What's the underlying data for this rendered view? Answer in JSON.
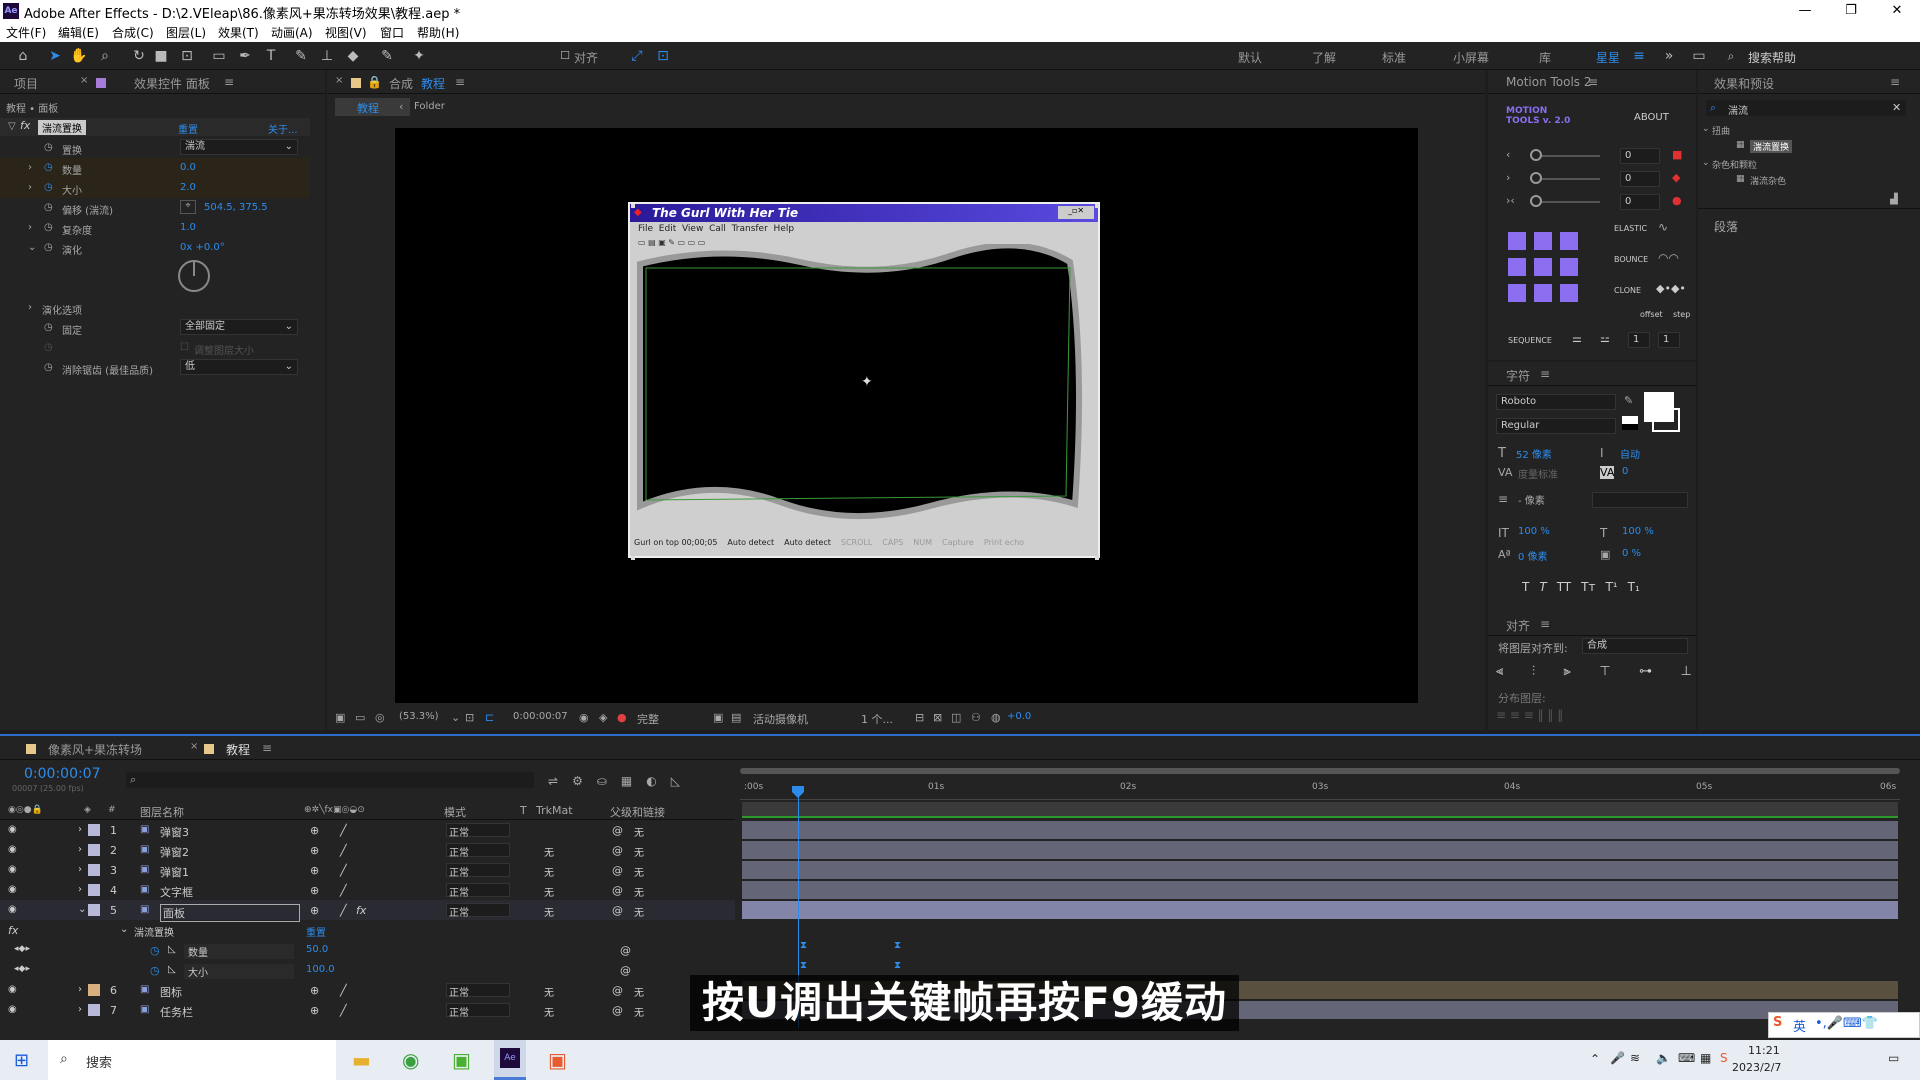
{
  "title_bar": {
    "app_title": "Adobe After Effects - D:\\2.VEleap\\86.像素风+果冻转场效果\\教程.aep *",
    "logo": "Ae"
  },
  "menu": [
    "文件(F)",
    "编辑(E)",
    "合成(C)",
    "图层(L)",
    "效果(T)",
    "动画(A)",
    "视图(V)",
    "窗口",
    "帮助(H)"
  ],
  "toolbar": {
    "align_label": "对齐",
    "workspaces": [
      "默认",
      "了解",
      "标准",
      "小屏幕",
      "库",
      "星星"
    ],
    "search_placeholder": "搜索帮助"
  },
  "effects_panel": {
    "tabs": [
      "项目",
      "效果控件 面板"
    ],
    "breadcrumb": "教程 • 面板",
    "effect_name": "湍流置换",
    "reset": "重置",
    "about": "关于...",
    "props": [
      {
        "label": "置换",
        "value": "湍流",
        "type": "dropdown"
      },
      {
        "label": "数量",
        "value": "0.0"
      },
      {
        "label": "大小",
        "value": "2.0"
      },
      {
        "label": "偏移 (湍流)",
        "value": "504.5, 375.5"
      },
      {
        "label": "复杂度",
        "value": "1.0"
      },
      {
        "label": "演化",
        "value": "0x +0.0°"
      },
      {
        "label": "演化选项",
        "value": ""
      },
      {
        "label": "固定",
        "value": "全部固定",
        "type": "dropdown"
      },
      {
        "label": "调整图层大小",
        "value": ""
      },
      {
        "label": "消除锯齿 (最佳品质)",
        "value": "低",
        "type": "dropdown"
      }
    ]
  },
  "composition": {
    "tab_prefix": "合成",
    "tab_name": "教程",
    "breadcrumb": [
      "教程",
      "Folder"
    ],
    "window_title": "The Gurl With Her Tie",
    "win_menu": [
      "File",
      "Edit",
      "View",
      "Call",
      "Transfer",
      "Help"
    ],
    "status": [
      "Gurl on top 00;00;05",
      "Auto detect",
      "Auto detect",
      "SCROLL",
      "CAPS",
      "NUM",
      "Capture",
      "Print echo"
    ],
    "zoom": "(53.3%)",
    "timecode": "0:00:00:07",
    "quality": "完整",
    "camera": "活动摄像机",
    "views": "1 个...",
    "exposure": "+0.0"
  },
  "motion_tools": {
    "title": "Motion Tools 2",
    "brand": "MOTION TOOLS v. 2.0",
    "about": "ABOUT",
    "sliders": [
      "0",
      "0",
      "0"
    ],
    "labels": [
      "ELASTIC",
      "BOUNCE",
      "CLONE"
    ],
    "offset_label": "offset",
    "step_label": "step",
    "sequence": "SEQUENCE",
    "seq_vals": [
      "1",
      "1"
    ]
  },
  "character": {
    "title": "字符",
    "font": "Roboto",
    "style": "Regular",
    "size": "52 像素",
    "leading": "自动",
    "kerning": "度量标准",
    "tracking": "0",
    "stroke": "- 像素",
    "vscale": "100 %",
    "hscale": "100 %",
    "baseline": "0 像素",
    "tsume": "0 %",
    "styles": [
      "T",
      "T",
      "TT",
      "Tт",
      "T¹",
      "T₁"
    ]
  },
  "align": {
    "title": "对齐",
    "align_to_label": "将图层对齐到:",
    "align_to": "合成",
    "distribute": "分布图层:"
  },
  "effects_presets": {
    "title": "效果和预设",
    "search": "湍流",
    "tree": [
      "扭曲",
      "湍流置换",
      "杂色和颗粒",
      "湍流杂色"
    ],
    "paragraph": "段落"
  },
  "timeline": {
    "tabs": [
      "像素风+果冻转场",
      "教程"
    ],
    "timecode": "0:00:00:07",
    "fps": "00007 (25.00 fps)",
    "headers": {
      "name": "图层名称",
      "mode": "模式",
      "t": "T",
      "trkmat": "TrkMat",
      "parent": "父级和链接"
    },
    "ruler": [
      ":00s",
      "01s",
      "02s",
      "03s",
      "04s",
      "05s",
      "06s"
    ],
    "layers": [
      {
        "num": "1",
        "name": "弹窗3",
        "mode": "正常",
        "trk": "",
        "parent": "无"
      },
      {
        "num": "2",
        "name": "弹窗2",
        "mode": "正常",
        "trk": "无",
        "parent": "无"
      },
      {
        "num": "3",
        "name": "弹窗1",
        "mode": "正常",
        "trk": "无",
        "parent": "无"
      },
      {
        "num": "4",
        "name": "文字框",
        "mode": "正常",
        "trk": "无",
        "parent": "无"
      },
      {
        "num": "5",
        "name": "面板",
        "mode": "正常",
        "trk": "无",
        "parent": "无"
      },
      {
        "num": "6",
        "name": "图标",
        "mode": "正常",
        "trk": "无",
        "parent": "无"
      },
      {
        "num": "7",
        "name": "任务栏",
        "mode": "正常",
        "trk": "无",
        "parent": "无"
      }
    ],
    "effect_group": "湍流置换",
    "effect_reset": "重置",
    "sub_props": [
      {
        "label": "数量",
        "value": "50.0"
      },
      {
        "label": "大小",
        "value": "100.0"
      }
    ]
  },
  "subtitle": "按U调出关键帧再按F9缓动",
  "taskbar": {
    "search": "搜索",
    "time": "11:21",
    "date": "2023/2/7",
    "ime": "英"
  }
}
